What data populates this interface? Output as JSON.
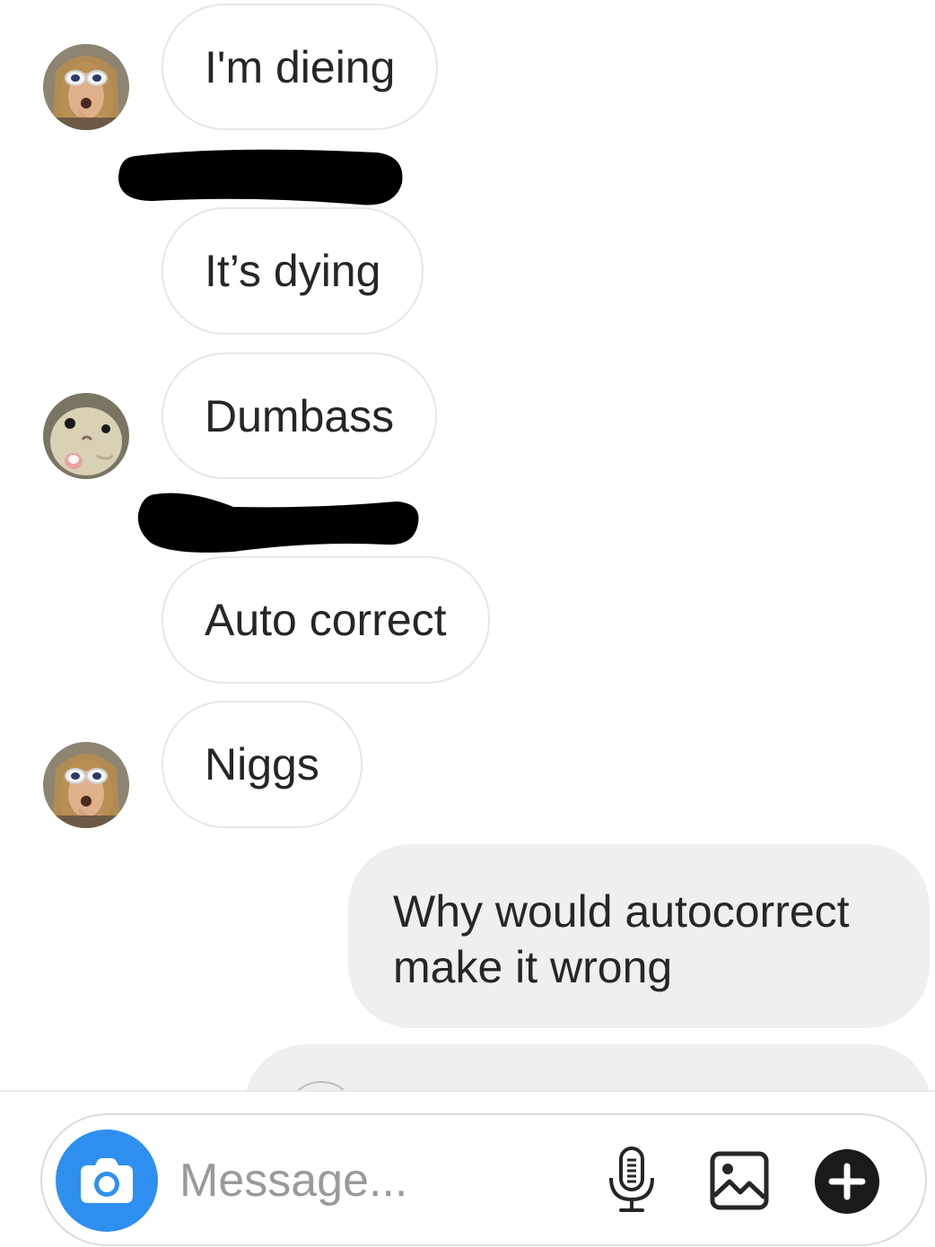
{
  "messages": [
    {
      "text": "I'm dieing",
      "sender": "them"
    },
    {
      "text": "It’s dying",
      "sender": "them"
    },
    {
      "text": "Dumbass",
      "sender": "them"
    },
    {
      "text": "Auto correct",
      "sender": "them"
    },
    {
      "text": "Niggs",
      "sender": "them"
    },
    {
      "text": "Why would autocorrect make it wrong",
      "sender": "me"
    }
  ],
  "composer": {
    "placeholder": "Message...",
    "camera_icon": "camera-icon",
    "mic_icon": "microphone-icon",
    "gallery_icon": "image-icon",
    "add_icon": "plus-icon"
  },
  "colors": {
    "accent": "#2f8ff0",
    "incoming_border": "#e6e6e6",
    "outgoing_bg": "#efefef",
    "redaction": "#000000"
  }
}
